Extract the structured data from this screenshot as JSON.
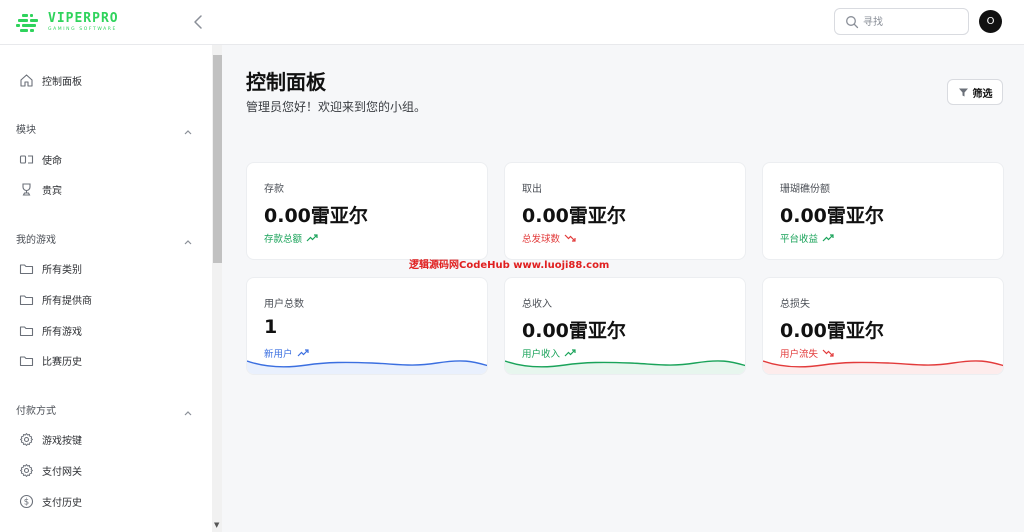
{
  "header": {
    "logo_main": "VIPERPRO",
    "logo_sub": "GAMING SOFTWARE",
    "search_placeholder": "寻找",
    "avatar_initial": "O"
  },
  "sidebar": {
    "dashboard": "控制面板",
    "sections": [
      {
        "title": "模块",
        "items": [
          "使命",
          "贵宾"
        ]
      },
      {
        "title": "我的游戏",
        "items": [
          "所有类别",
          "所有提供商",
          "所有游戏",
          "比赛历史"
        ]
      },
      {
        "title": "付款方式",
        "items": [
          "游戏按键",
          "支付网关",
          "支付历史"
        ]
      }
    ]
  },
  "main": {
    "title": "控制面板",
    "subtitle": "管理员您好！欢迎来到您的小组。",
    "filter_label": "筛选",
    "cards": [
      {
        "label": "存款",
        "value": "0.00雷亚尔",
        "trend": "存款总额",
        "trend_dir": "up",
        "color": "#1aa35a"
      },
      {
        "label": "取出",
        "value": "0.00雷亚尔",
        "trend": "总发球数",
        "trend_dir": "down",
        "color": "#e23b3b"
      },
      {
        "label": "珊瑚礁份额",
        "value": "0.00雷亚尔",
        "trend": "平台收益",
        "trend_dir": "up",
        "color": "#1aa35a"
      },
      {
        "label": "用户总数",
        "value": "1",
        "trend": "新用户",
        "trend_dir": "up",
        "color": "#3b6fe0"
      },
      {
        "label": "总收入",
        "value": "0.00雷亚尔",
        "trend": "用户收入",
        "trend_dir": "up",
        "color": "#1aa35a"
      },
      {
        "label": "总损失",
        "value": "0.00雷亚尔",
        "trend": "用户流失",
        "trend_dir": "down",
        "color": "#e23b3b"
      }
    ]
  },
  "watermark": "逻辑源码网CodeHub  www.luoji88.com"
}
